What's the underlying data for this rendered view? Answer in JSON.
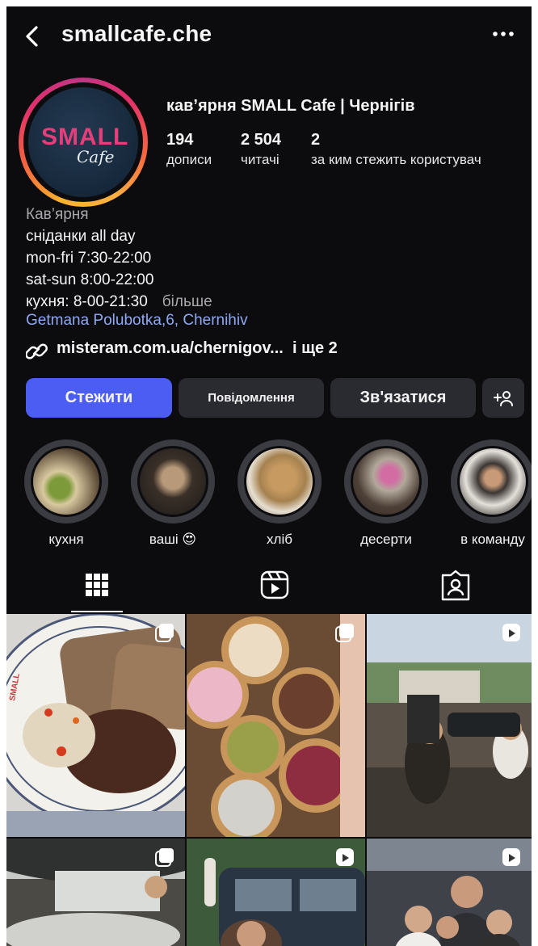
{
  "header": {
    "username": "smallcafe.che",
    "back_icon": "chevron-left-icon",
    "more_icon": "ellipsis-icon"
  },
  "profile": {
    "display_name": "кав’ярня SMALL Cafe | Чернігів",
    "avatar_logo_text": "SMALL",
    "avatar_script_text": "Cafe",
    "stats": [
      {
        "value": "194",
        "label": "дописи"
      },
      {
        "value": "2 504",
        "label": "читачі"
      },
      {
        "value": "2",
        "label": "за ким стежить користувач"
      }
    ]
  },
  "bio": {
    "category": "Кав’ярня",
    "lines": [
      "сніданки all day",
      "mon-fri 7:30-22:00",
      "sat-sun 8:00-22:00",
      "кухня: 8-00-21:30"
    ],
    "more_label": "більше",
    "address": "Getmana Polubotka,6, Chernihiv",
    "link": "misteram.com.ua/chernigov...",
    "link_extra": "і ще 2"
  },
  "actions": {
    "follow": "Стежити",
    "message": "Повідомлення",
    "contact": "Зв'язатися",
    "add_user_icon": "add-user-icon"
  },
  "highlights": [
    {
      "label": "кухня"
    },
    {
      "label": "ваші 😍"
    },
    {
      "label": "хліб"
    },
    {
      "label": "десерти"
    },
    {
      "label": "в команду"
    }
  ],
  "tabs": [
    {
      "icon": "grid-icon",
      "active": true
    },
    {
      "icon": "reels-icon",
      "active": false
    },
    {
      "icon": "tagged-icon",
      "active": false
    }
  ],
  "colors": {
    "background": "#0c0c0f",
    "follow_button": "#4c5df4",
    "secondary_button": "#2a2b31",
    "address_link": "#8fa8f2",
    "logo_pink": "#e43e7b"
  }
}
